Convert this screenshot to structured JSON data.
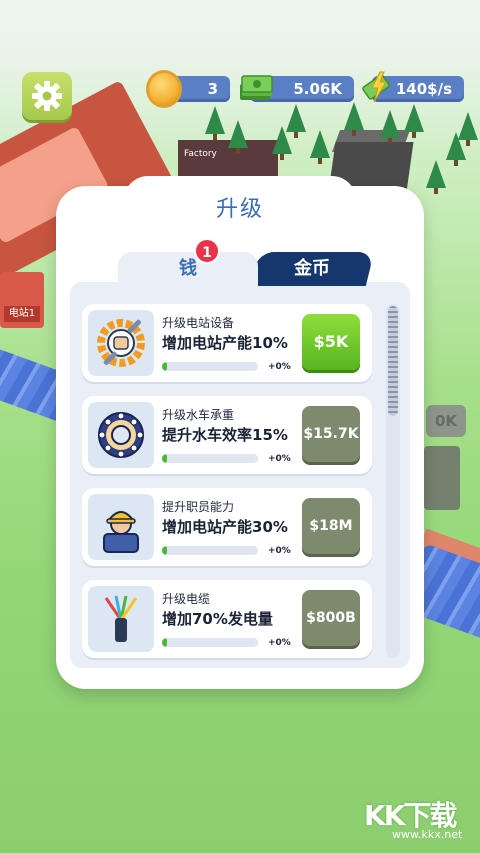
{
  "hud": {
    "gold": "3",
    "cash": "5.06K",
    "rate": "140$/s"
  },
  "panel": {
    "title": "升级",
    "tabs": [
      {
        "label": "钱",
        "active": true,
        "badge": "1"
      },
      {
        "label": "金币",
        "active": false
      }
    ]
  },
  "upgrades": [
    {
      "icon": "gear-wrench-icon",
      "title": "升级电站设备",
      "desc": "增加电站产能10%",
      "progress_pct": "+0%",
      "progress": 0.05,
      "price": "$5K",
      "enabled": true
    },
    {
      "icon": "bearing-icon",
      "title": "升级水车承重",
      "desc": "提升水车效率15%",
      "progress_pct": "+0%",
      "progress": 0.05,
      "price": "$15.7K",
      "enabled": false
    },
    {
      "icon": "worker-icon",
      "title": "提升职员能力",
      "desc": "增加电站产能30%",
      "progress_pct": "+0%",
      "progress": 0.05,
      "price": "$18M",
      "enabled": false
    },
    {
      "icon": "cable-icon",
      "title": "升级电缆",
      "desc": "增加70%发电量",
      "progress_pct": "+0%",
      "progress": 0.05,
      "price": "$800B",
      "enabled": false
    }
  ],
  "scene": {
    "factory_sign": "Factory",
    "shed_sign": "电站1",
    "ghost_price": "0K"
  },
  "watermark": {
    "logo": "KK下载",
    "url": "www.kkx.net"
  },
  "colors": {
    "accent": "#3b6db5",
    "active_tab_dark": "#16376e",
    "buy_green": "#58b520",
    "disabled_price": "#7e8a6d",
    "badge_red": "#e8334a"
  }
}
